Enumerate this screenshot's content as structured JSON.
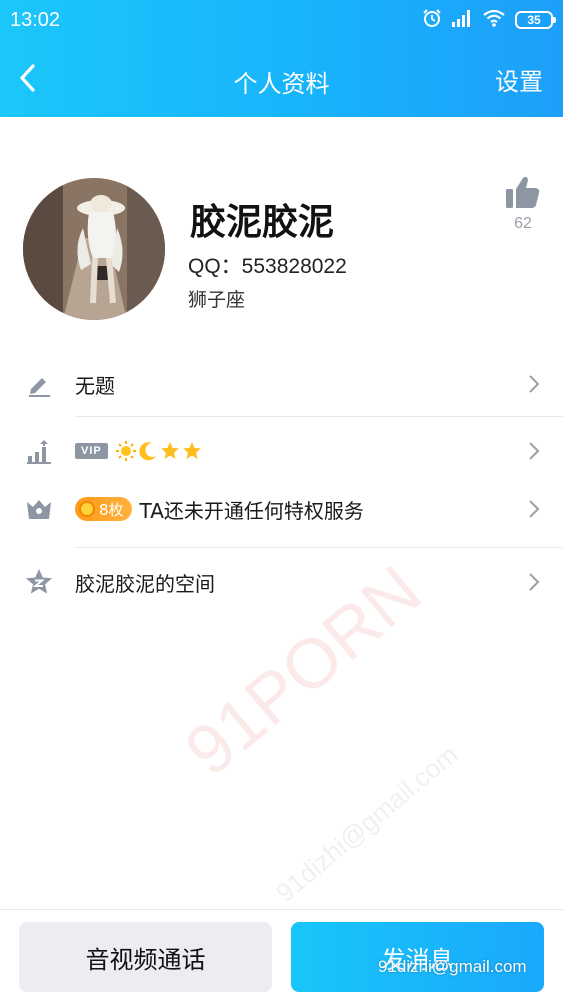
{
  "status_bar": {
    "time": "13:02",
    "battery": "35",
    "icons": [
      "alarm-icon",
      "signal-icon",
      "wifi-icon",
      "battery-icon"
    ]
  },
  "nav": {
    "back_icon": "chevron-left-icon",
    "title": "个人资料",
    "settings_label": "设置"
  },
  "profile": {
    "nickname": "胶泥胶泥",
    "qq_line": "QQ：553828022",
    "zodiac": "狮子座",
    "like_count": "62"
  },
  "menu": {
    "signature": {
      "icon": "pencil-icon",
      "text": "无题"
    },
    "level": {
      "icon": "level-chart-icon",
      "vip_label": "VIP",
      "level_icons": [
        "sun-icon",
        "moon-icon",
        "star-icon",
        "star-icon"
      ]
    },
    "privilege": {
      "icon": "crown-icon",
      "badge_text": "8枚",
      "text": "TA还未开通任何特权服务"
    },
    "space": {
      "icon": "qzone-star-icon",
      "text": "胶泥胶泥的空间"
    }
  },
  "bottom": {
    "call_label": "音视频通话",
    "message_label": "发消息"
  },
  "watermark": {
    "brand": "91PORN",
    "email": "91dizhi@gmail.com",
    "overlay_email": "91dizhi@gmail.com"
  },
  "colors": {
    "header_start": "#1bc7fb",
    "header_end": "#1d9ff9",
    "message_button": "#18c6fa",
    "call_button": "#ebedf3",
    "badge_orange": "#ff9a1a",
    "icon_gray": "#8f96a3"
  }
}
